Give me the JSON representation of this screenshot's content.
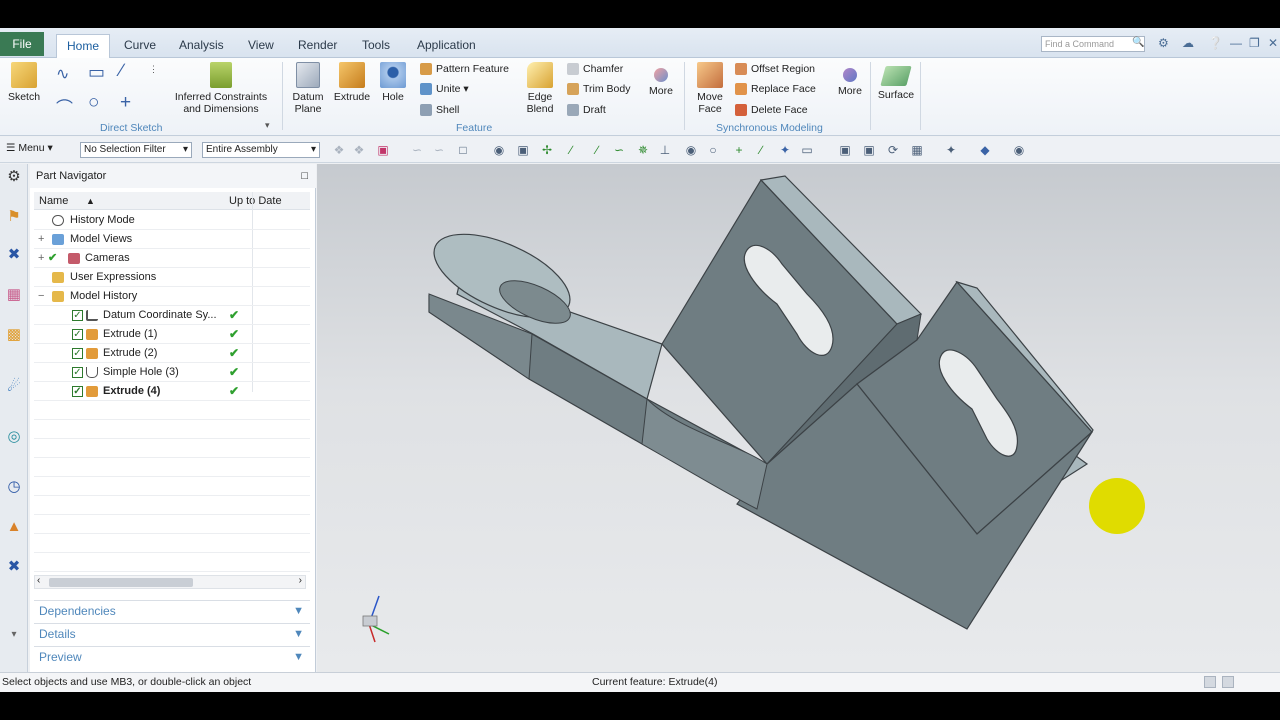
{
  "tabs": {
    "file": "File",
    "items": [
      "Home",
      "Curve",
      "Analysis",
      "View",
      "Render",
      "Tools",
      "Application"
    ]
  },
  "search": {
    "placeholder": "Find a Command"
  },
  "ribbon": {
    "sketch": "Sketch",
    "inferred": "Inferred Constraints and Dimensions",
    "direct_sketch": "Direct Sketch",
    "datum_plane": "Datum Plane",
    "extrude": "Extrude",
    "hole": "Hole",
    "pattern_feature": "Pattern Feature",
    "unite": "Unite",
    "shell": "Shell",
    "edge_blend": "Edge Blend",
    "chamfer": "Chamfer",
    "trim_body": "Trim Body",
    "draft": "Draft",
    "more1": "More",
    "feature": "Feature",
    "move_face": "Move Face",
    "offset_region": "Offset Region",
    "replace_face": "Replace Face",
    "delete_face": "Delete Face",
    "more2": "More",
    "synchronous": "Synchronous Modeling",
    "surface": "Surface"
  },
  "toolbar": {
    "menu": "Menu",
    "selection_filter": "No Selection Filter",
    "scope": "Entire Assembly"
  },
  "navigator": {
    "title": "Part Navigator",
    "col_name": "Name",
    "col_uptodate": "Up to Date",
    "rows": [
      {
        "label": "History Mode"
      },
      {
        "label": "Model Views"
      },
      {
        "label": "Cameras"
      },
      {
        "label": "User Expressions"
      },
      {
        "label": "Model History"
      },
      {
        "label": "Datum Coordinate Sy..."
      },
      {
        "label": "Extrude (1)"
      },
      {
        "label": "Extrude (2)"
      },
      {
        "label": "Simple Hole (3)"
      },
      {
        "label": "Extrude (4)"
      }
    ],
    "dependencies": "Dependencies",
    "details": "Details",
    "preview": "Preview"
  },
  "status": {
    "left": "Select objects and use MB3, or double-click an object",
    "center": "Current feature: Extrude(4)"
  },
  "colors": {
    "file_tab": "#3a7a54",
    "accent": "#4f87bb",
    "model_face_light": "#a9b8bd",
    "model_face_dark": "#6f7d82",
    "cursor_highlight": "#e0dc00"
  }
}
